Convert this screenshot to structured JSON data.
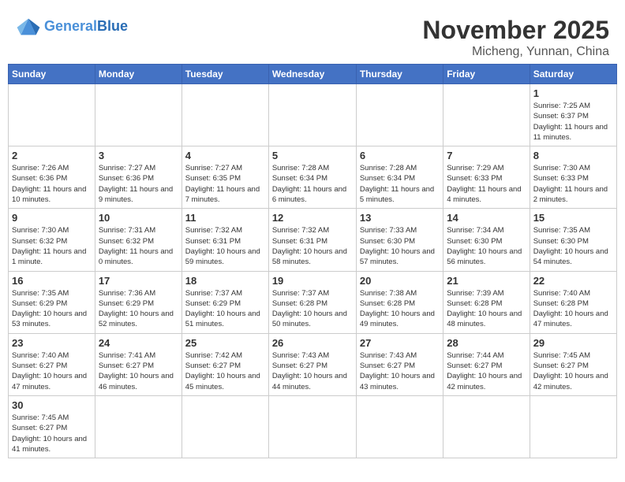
{
  "header": {
    "logo_general": "General",
    "logo_blue": "Blue",
    "month_title": "November 2025",
    "location": "Micheng, Yunnan, China"
  },
  "days_of_week": [
    "Sunday",
    "Monday",
    "Tuesday",
    "Wednesday",
    "Thursday",
    "Friday",
    "Saturday"
  ],
  "weeks": [
    [
      {
        "day": "",
        "info": ""
      },
      {
        "day": "",
        "info": ""
      },
      {
        "day": "",
        "info": ""
      },
      {
        "day": "",
        "info": ""
      },
      {
        "day": "",
        "info": ""
      },
      {
        "day": "",
        "info": ""
      },
      {
        "day": "1",
        "info": "Sunrise: 7:25 AM\nSunset: 6:37 PM\nDaylight: 11 hours and 11 minutes."
      }
    ],
    [
      {
        "day": "2",
        "info": "Sunrise: 7:26 AM\nSunset: 6:36 PM\nDaylight: 11 hours and 10 minutes."
      },
      {
        "day": "3",
        "info": "Sunrise: 7:27 AM\nSunset: 6:36 PM\nDaylight: 11 hours and 9 minutes."
      },
      {
        "day": "4",
        "info": "Sunrise: 7:27 AM\nSunset: 6:35 PM\nDaylight: 11 hours and 7 minutes."
      },
      {
        "day": "5",
        "info": "Sunrise: 7:28 AM\nSunset: 6:34 PM\nDaylight: 11 hours and 6 minutes."
      },
      {
        "day": "6",
        "info": "Sunrise: 7:28 AM\nSunset: 6:34 PM\nDaylight: 11 hours and 5 minutes."
      },
      {
        "day": "7",
        "info": "Sunrise: 7:29 AM\nSunset: 6:33 PM\nDaylight: 11 hours and 4 minutes."
      },
      {
        "day": "8",
        "info": "Sunrise: 7:30 AM\nSunset: 6:33 PM\nDaylight: 11 hours and 2 minutes."
      }
    ],
    [
      {
        "day": "9",
        "info": "Sunrise: 7:30 AM\nSunset: 6:32 PM\nDaylight: 11 hours and 1 minute."
      },
      {
        "day": "10",
        "info": "Sunrise: 7:31 AM\nSunset: 6:32 PM\nDaylight: 11 hours and 0 minutes."
      },
      {
        "day": "11",
        "info": "Sunrise: 7:32 AM\nSunset: 6:31 PM\nDaylight: 10 hours and 59 minutes."
      },
      {
        "day": "12",
        "info": "Sunrise: 7:32 AM\nSunset: 6:31 PM\nDaylight: 10 hours and 58 minutes."
      },
      {
        "day": "13",
        "info": "Sunrise: 7:33 AM\nSunset: 6:30 PM\nDaylight: 10 hours and 57 minutes."
      },
      {
        "day": "14",
        "info": "Sunrise: 7:34 AM\nSunset: 6:30 PM\nDaylight: 10 hours and 56 minutes."
      },
      {
        "day": "15",
        "info": "Sunrise: 7:35 AM\nSunset: 6:30 PM\nDaylight: 10 hours and 54 minutes."
      }
    ],
    [
      {
        "day": "16",
        "info": "Sunrise: 7:35 AM\nSunset: 6:29 PM\nDaylight: 10 hours and 53 minutes."
      },
      {
        "day": "17",
        "info": "Sunrise: 7:36 AM\nSunset: 6:29 PM\nDaylight: 10 hours and 52 minutes."
      },
      {
        "day": "18",
        "info": "Sunrise: 7:37 AM\nSunset: 6:29 PM\nDaylight: 10 hours and 51 minutes."
      },
      {
        "day": "19",
        "info": "Sunrise: 7:37 AM\nSunset: 6:28 PM\nDaylight: 10 hours and 50 minutes."
      },
      {
        "day": "20",
        "info": "Sunrise: 7:38 AM\nSunset: 6:28 PM\nDaylight: 10 hours and 49 minutes."
      },
      {
        "day": "21",
        "info": "Sunrise: 7:39 AM\nSunset: 6:28 PM\nDaylight: 10 hours and 48 minutes."
      },
      {
        "day": "22",
        "info": "Sunrise: 7:40 AM\nSunset: 6:28 PM\nDaylight: 10 hours and 47 minutes."
      }
    ],
    [
      {
        "day": "23",
        "info": "Sunrise: 7:40 AM\nSunset: 6:27 PM\nDaylight: 10 hours and 47 minutes."
      },
      {
        "day": "24",
        "info": "Sunrise: 7:41 AM\nSunset: 6:27 PM\nDaylight: 10 hours and 46 minutes."
      },
      {
        "day": "25",
        "info": "Sunrise: 7:42 AM\nSunset: 6:27 PM\nDaylight: 10 hours and 45 minutes."
      },
      {
        "day": "26",
        "info": "Sunrise: 7:43 AM\nSunset: 6:27 PM\nDaylight: 10 hours and 44 minutes."
      },
      {
        "day": "27",
        "info": "Sunrise: 7:43 AM\nSunset: 6:27 PM\nDaylight: 10 hours and 43 minutes."
      },
      {
        "day": "28",
        "info": "Sunrise: 7:44 AM\nSunset: 6:27 PM\nDaylight: 10 hours and 42 minutes."
      },
      {
        "day": "29",
        "info": "Sunrise: 7:45 AM\nSunset: 6:27 PM\nDaylight: 10 hours and 42 minutes."
      }
    ],
    [
      {
        "day": "30",
        "info": "Sunrise: 7:45 AM\nSunset: 6:27 PM\nDaylight: 10 hours and 41 minutes."
      },
      {
        "day": "",
        "info": ""
      },
      {
        "day": "",
        "info": ""
      },
      {
        "day": "",
        "info": ""
      },
      {
        "day": "",
        "info": ""
      },
      {
        "day": "",
        "info": ""
      },
      {
        "day": "",
        "info": ""
      }
    ]
  ]
}
